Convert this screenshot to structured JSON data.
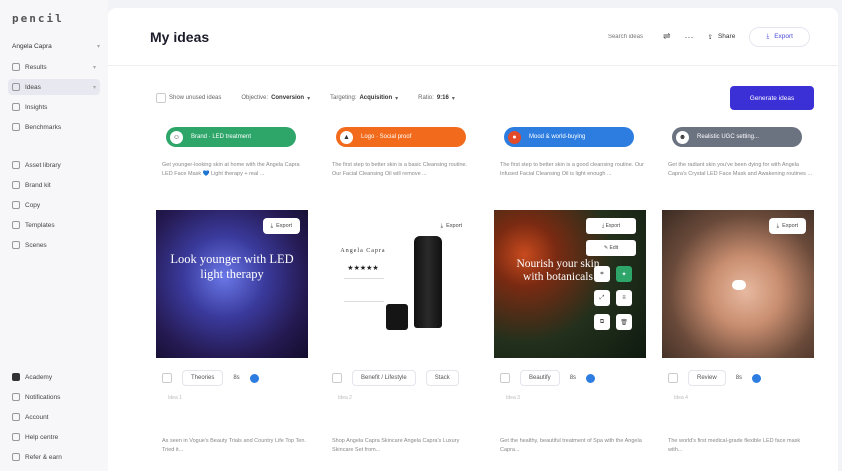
{
  "app": {
    "logo": "pencil"
  },
  "sidebar": {
    "user": "Angela Capra",
    "items": [
      {
        "label": "Results",
        "icon": "results-icon",
        "active": false
      },
      {
        "label": "Ideas",
        "icon": "ideas-icon",
        "active": true
      },
      {
        "label": "Insights",
        "icon": "insights-icon",
        "active": false
      },
      {
        "label": "Benchmarks",
        "icon": "benchmarks-icon",
        "active": false
      }
    ],
    "library": [
      {
        "label": "Asset library",
        "icon": "asset-library-icon"
      },
      {
        "label": "Brand kit",
        "icon": "brand-kit-icon"
      },
      {
        "label": "Copy",
        "icon": "copy-icon"
      },
      {
        "label": "Templates",
        "icon": "templates-icon"
      },
      {
        "label": "Scenes",
        "icon": "scenes-icon"
      }
    ],
    "bottom": [
      {
        "label": "Academy",
        "icon": "academy-icon"
      },
      {
        "label": "Notifications",
        "icon": "notifications-icon"
      },
      {
        "label": "Account",
        "icon": "account-icon"
      },
      {
        "label": "Help centre",
        "icon": "help-icon"
      },
      {
        "label": "Refer & earn",
        "icon": "refer-icon"
      }
    ]
  },
  "header": {
    "title": "My ideas",
    "search_placeholder": "Search ideas",
    "share_label": "Share",
    "export_label": "Export"
  },
  "filters": {
    "f1": "Show unused ideas",
    "objective_label": "Objective:",
    "objective_value": "Conversion",
    "targeting_label": "Targeting:",
    "targeting_value": "Acquisition",
    "ratio_label": "Ratio:",
    "ratio_value": "9:16",
    "generate_label": "Generate ideas"
  },
  "cards": [
    {
      "tag": "Brand · LED treatment",
      "tag_color": "#2ea66a",
      "tag_icon": "person-icon",
      "caption": "Get younger-looking skin at home with the Angela Capra LED Face Mask 💙 Light therapy + real ...",
      "export": "Export",
      "overlay": "Look younger with LED light therapy",
      "chip": "Theories",
      "count": "8s",
      "sub": "Idea 1",
      "body": "As seen in Vogue's Beauty Trials and Country Life Top Ten. Tried it..."
    },
    {
      "tag": "Logo · Social proof",
      "tag_color": "#f26a1b",
      "tag_icon": "flame-icon",
      "caption": "The first step to better skin is a basic Cleansing routine. Our Facial Cleansing Oil will remove ...",
      "export": "Export",
      "overlay": "",
      "product_title": "Angela Capra",
      "stars": "★★★★★",
      "chip": "Benefit / Lifestyle",
      "count": "Stack",
      "sub": "Idea 2",
      "body": "Shop Angela Capra Skincare Angela Capra's Luxury Skincare Set from..."
    },
    {
      "tag": "Mood & world-buying",
      "tag_color": "#2d7de0",
      "tag_icon": "globe-icon",
      "caption": "The first step to better skin is a good cleansing routine. Our Infused Facial Cleansing Oil is light enough ...",
      "export": "Export",
      "edit": "Edit",
      "overlay": "Nourish your skin with botanicals",
      "chip": "Beautify",
      "count": "8s",
      "sub": "Idea 3",
      "body": "Get the healthy, beautiful treatment of Spa with the Angela Capra..."
    },
    {
      "tag": "Realistic UGC setting...",
      "tag_color": "#6b7280",
      "tag_icon": "face-icon",
      "caption": "Get the radiant skin you've been dying for with Angela Capra's Crystal LED Face Mask and Awakening routines ...",
      "export": "Export",
      "overlay": "",
      "chip": "Review",
      "count": "8s",
      "sub": "Idea 4",
      "body": "The world's first medical-grade flexible LED face mask with..."
    }
  ]
}
